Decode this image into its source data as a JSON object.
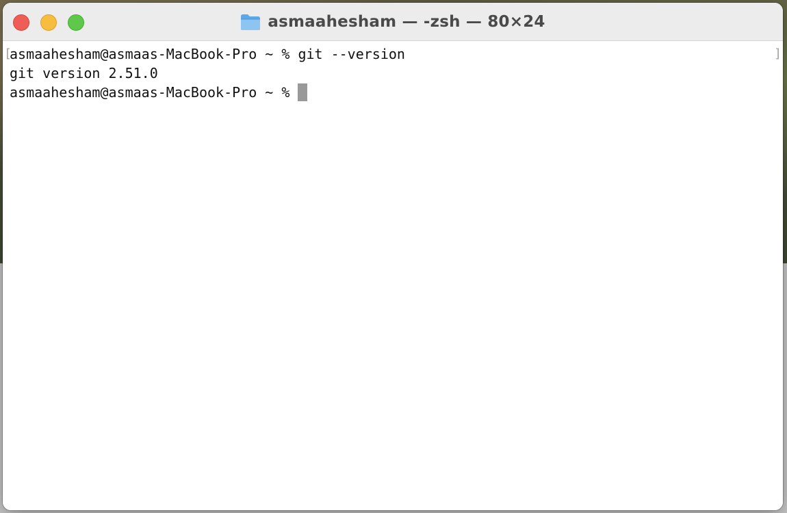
{
  "window": {
    "title": "asmaahesham — -zsh — 80×24",
    "title_icon": "folder-icon",
    "controls": {
      "close_color": "#ee5e56",
      "minimize_color": "#f6bd3e",
      "zoom_color": "#5fc84a"
    }
  },
  "terminal": {
    "lines": [
      {
        "prompt": "asmaahesham@asmaas-MacBook-Pro ~ % ",
        "text": "git --version"
      },
      {
        "prompt": "",
        "text": "git version 2.51.0"
      },
      {
        "prompt": "asmaahesham@asmaas-MacBook-Pro ~ % ",
        "text": ""
      }
    ],
    "cursor_color": "#999999",
    "background_color": "#ffffff",
    "text_color": "#111111"
  }
}
